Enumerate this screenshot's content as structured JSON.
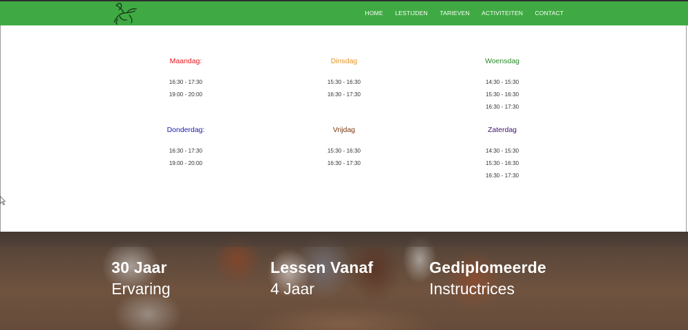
{
  "header": {
    "nav": [
      {
        "label": "HOME"
      },
      {
        "label": "LESTIJDEN"
      },
      {
        "label": "TARIEVEN"
      },
      {
        "label": "ACTIVITEITEN"
      },
      {
        "label": "CONTACT"
      }
    ],
    "color": "#3faa43"
  },
  "schedule": {
    "days": [
      {
        "name": "Maandag:",
        "color": "#e5161a",
        "slots": [
          "16:30 - 17:30",
          "19:00 - 20:00"
        ]
      },
      {
        "name": "Dinsdag",
        "color": "#e8931c",
        "slots": [
          "15:30 - 16:30",
          "16:30 - 17:30"
        ]
      },
      {
        "name": "Woensdag",
        "color": "#2a8a2a",
        "slots": [
          "14:30 - 15:30",
          "15:30 - 16:30",
          "16:30 - 17:30"
        ]
      },
      {
        "name": "Donderdag:",
        "color": "#1a1aa8",
        "slots": [
          "16:30 - 17:30",
          "19:00 - 20:00"
        ]
      },
      {
        "name": "Vrijdag",
        "color": "#7a3510",
        "slots": [
          "15:30 - 16:30",
          "16:30 - 17:30"
        ]
      },
      {
        "name": "Zaterdag",
        "color": "#3d0f6b",
        "slots": [
          "14:30 - 15:30",
          "15:30 - 16:30",
          "16:30 - 17:30"
        ]
      }
    ]
  },
  "hero": {
    "stats": [
      {
        "title": "30 Jaar",
        "subtitle": "Ervaring"
      },
      {
        "title": "Lessen Vanaf",
        "subtitle": "4 Jaar"
      },
      {
        "title": "Gediplomeerde",
        "subtitle": "Instructrices"
      }
    ]
  }
}
